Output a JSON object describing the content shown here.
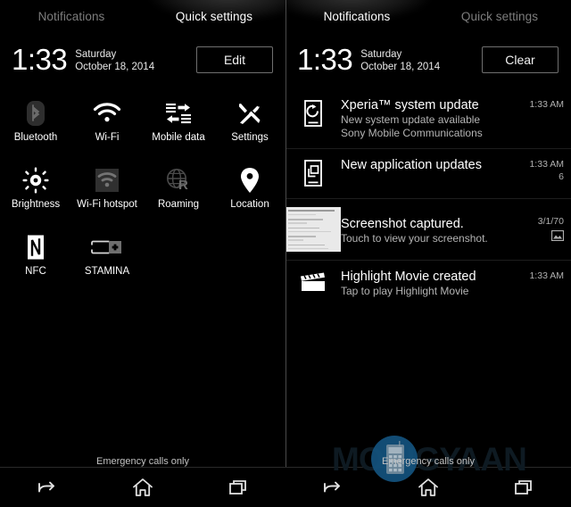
{
  "left_panel": {
    "tabs": [
      {
        "label": "Notifications",
        "active": false
      },
      {
        "label": "Quick settings",
        "active": true
      }
    ],
    "clock": {
      "time": "1:33",
      "day": "Saturday",
      "date": "October 18, 2014"
    },
    "action_button": {
      "label": "Edit"
    },
    "tiles": [
      {
        "label": "Bluetooth",
        "icon": "bluetooth-icon",
        "state": "off"
      },
      {
        "label": "Wi-Fi",
        "icon": "wifi-icon",
        "state": "on"
      },
      {
        "label": "Mobile data",
        "icon": "mobile-data-icon",
        "state": "on"
      },
      {
        "label": "Settings",
        "icon": "settings-icon",
        "state": "on"
      },
      {
        "label": "Brightness",
        "icon": "brightness-icon",
        "state": "on"
      },
      {
        "label": "Wi-Fi hotspot",
        "icon": "wifi-hotspot-icon",
        "state": "off"
      },
      {
        "label": "Roaming",
        "icon": "roaming-icon",
        "state": "off"
      },
      {
        "label": "Location",
        "icon": "location-icon",
        "state": "on"
      },
      {
        "label": "NFC",
        "icon": "nfc-icon",
        "state": "on"
      },
      {
        "label": "STAMINA",
        "icon": "stamina-icon",
        "state": "off"
      }
    ],
    "status_text": "Emergency calls only"
  },
  "right_panel": {
    "tabs": [
      {
        "label": "Notifications",
        "active": true
      },
      {
        "label": "Quick settings",
        "active": false
      }
    ],
    "clock": {
      "time": "1:33",
      "day": "Saturday",
      "date": "October 18, 2014"
    },
    "action_button": {
      "label": "Clear"
    },
    "notifications": [
      {
        "icon": "system-update-icon",
        "title": "Xperia™ system update",
        "line1": "New system update available",
        "line2": "Sony Mobile Communications",
        "time": "1:33 AM",
        "count": "",
        "meta_icon": ""
      },
      {
        "icon": "app-updates-icon",
        "title": "New application updates",
        "line1": "",
        "line2": "",
        "time": "1:33 AM",
        "count": "6",
        "meta_icon": ""
      },
      {
        "icon": "screenshot-thumbnail",
        "title": "Screenshot captured.",
        "line1": "Touch to view your screenshot.",
        "line2": "",
        "time": "3/1/70",
        "count": "",
        "meta_icon": "image-icon"
      },
      {
        "icon": "movie-clapperboard-icon",
        "title": "Highlight Movie created",
        "line1": "Tap to play Highlight Movie",
        "line2": "",
        "time": "1:33 AM",
        "count": "",
        "meta_icon": ""
      }
    ],
    "status_text": "Emergency calls only"
  },
  "navbar": {
    "buttons": [
      {
        "name": "back-button",
        "icon": "back-arrow-icon"
      },
      {
        "name": "home-button",
        "icon": "home-icon"
      },
      {
        "name": "recents-button",
        "icon": "recents-icon"
      }
    ]
  },
  "watermark": {
    "text": "MOBIGYAAN",
    "logo_color": "#14527e"
  },
  "colors": {
    "background": "#000000",
    "text_primary": "#ffffff",
    "text_secondary": "#b4b4b4",
    "tab_inactive": "#7d7d7d",
    "icon_disabled": "#4f4f4f",
    "divider": "#4a4a4a"
  }
}
